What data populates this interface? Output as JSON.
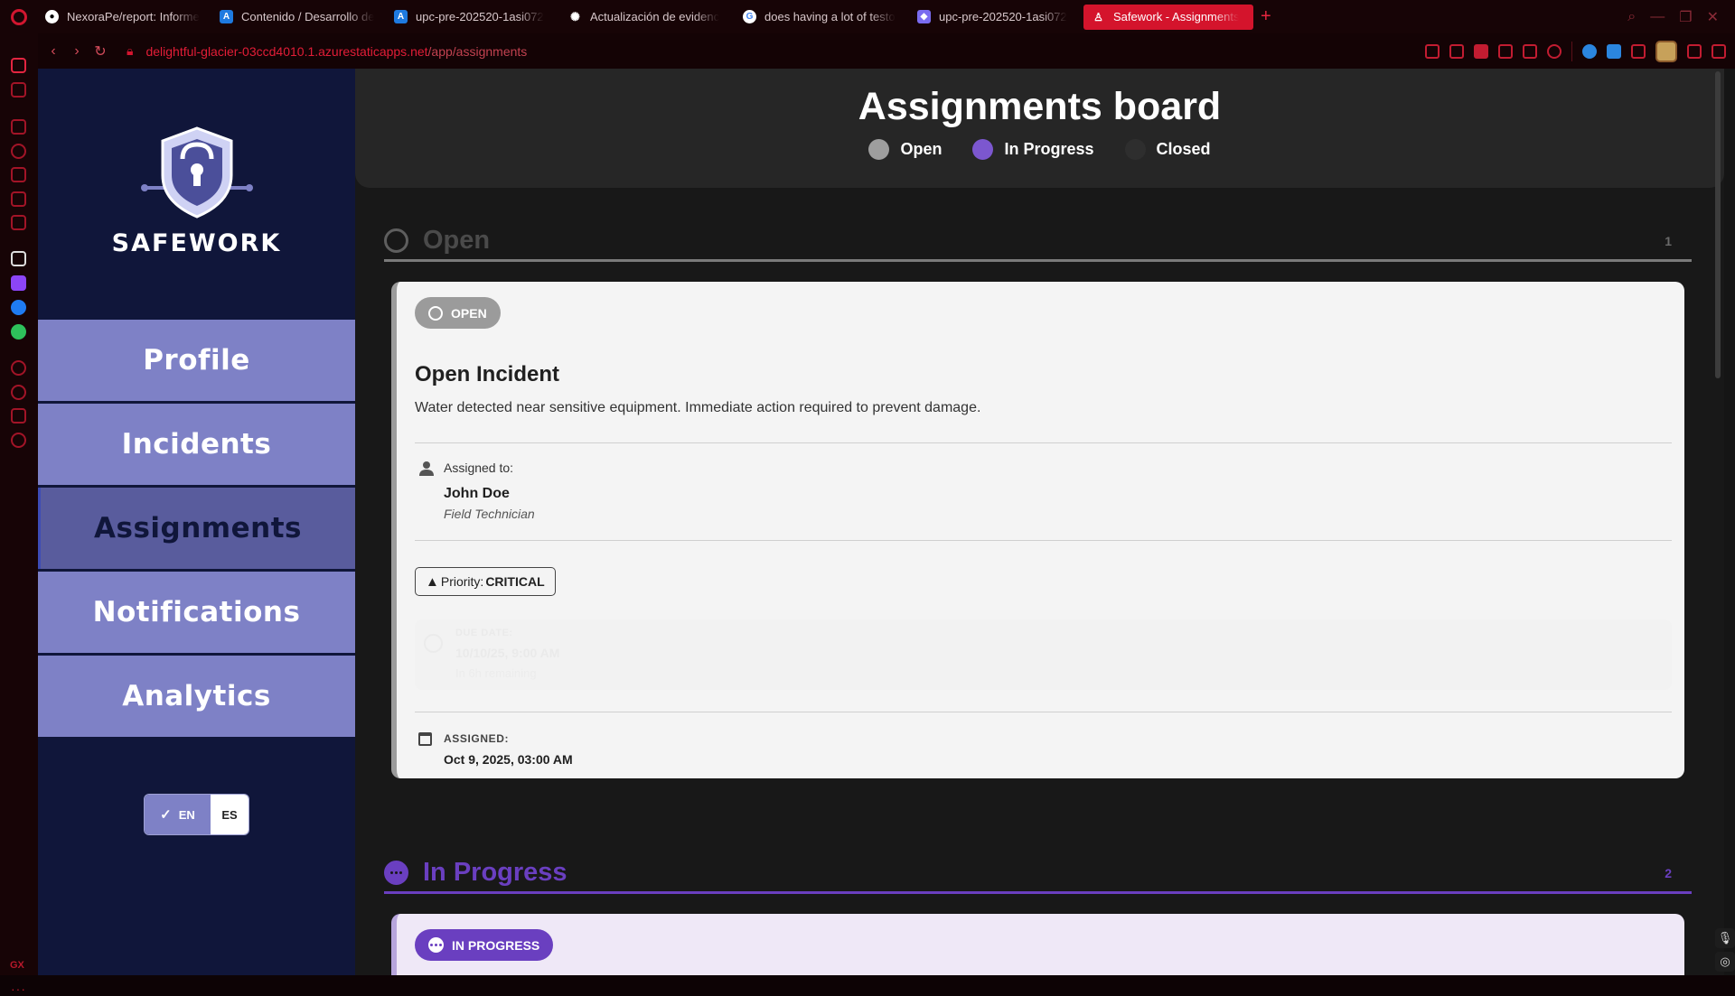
{
  "browser": {
    "tabs": [
      {
        "label": "NexoraPe/report: Informe",
        "favicon_color": "#ffffff",
        "favicon_glyph": "github-icon"
      },
      {
        "label": "Contenido / Desarrollo de",
        "favicon_color": "#1e7ae0",
        "favicon_glyph": "azure-devops-icon"
      },
      {
        "label": "upc-pre-202520-1asi072",
        "favicon_color": "#1e7ae0",
        "favicon_glyph": "azure-devops-icon"
      },
      {
        "label": "Actualización de evidenc",
        "favicon_color": "#ffffff",
        "favicon_glyph": "openai-icon"
      },
      {
        "label": "does having a lot of testo",
        "favicon_color": "#ffffff",
        "favicon_glyph": "google-icon"
      },
      {
        "label": "upc-pre-202520-1asi072",
        "favicon_color": "#7a6cf0",
        "favicon_glyph": "shield-icon"
      },
      {
        "label": "Safework - Assignments",
        "favicon_color": "#ffffff",
        "favicon_glyph": "person-icon"
      }
    ],
    "url": {
      "host": "delightful-glacier-03ccd4010.1.azurestaticapps.net",
      "path": "/app/assignments"
    },
    "accent_color": "#d4142c"
  },
  "sidebar": {
    "brand": "SAFEWORK",
    "items": [
      {
        "label": "Profile"
      },
      {
        "label": "Incidents"
      },
      {
        "label": "Assignments"
      },
      {
        "label": "Notifications"
      },
      {
        "label": "Analytics"
      }
    ],
    "active_item": "Assignments",
    "language": {
      "selected": "EN",
      "other": "ES"
    }
  },
  "board": {
    "title": "Assignments board",
    "legend": [
      {
        "label": "Open",
        "color": "#9e9e9e"
      },
      {
        "label": "In Progress",
        "color": "#7c57cf"
      },
      {
        "label": "Closed",
        "color": "#2e2e2e"
      }
    ]
  },
  "sections": {
    "open": {
      "title": "Open",
      "count": "1",
      "card": {
        "status": "OPEN",
        "title": "Open Incident",
        "description": "Water detected near sensitive equipment. Immediate action required to prevent damage.",
        "assigned_to_label": "Assigned to:",
        "assignee_name": "John Doe",
        "assignee_role": "Field Technician",
        "priority_label": "Priority:",
        "priority_value": "CRITICAL",
        "due_label": "DUE DATE:",
        "due_date": "10/10/25, 9:00 AM",
        "due_note": "In 6h remaining",
        "assigned_label": "ASSIGNED:",
        "assigned_date": "Oct 9, 2025, 03:00 AM"
      }
    },
    "in_progress": {
      "title": "In Progress",
      "count": "2",
      "card": {
        "status": "IN PROGRESS"
      }
    }
  }
}
